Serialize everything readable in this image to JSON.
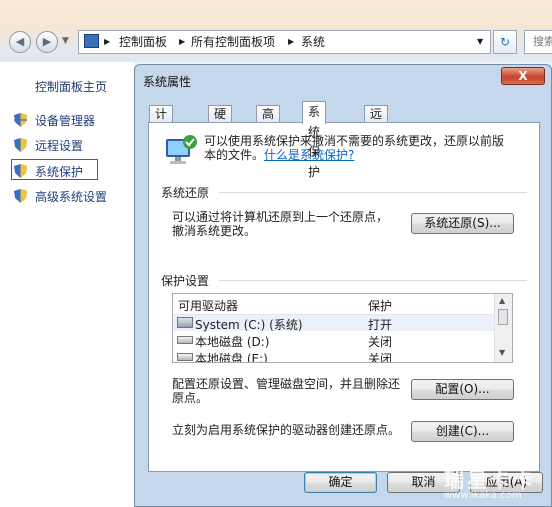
{
  "explorer": {
    "breadcrumb": [
      "控制面板",
      "所有控制面板项",
      "系统"
    ],
    "search_placeholder": "搜索"
  },
  "left_nav": {
    "title": "控制面板主页",
    "items": [
      {
        "label": "设备管理器"
      },
      {
        "label": "远程设置"
      },
      {
        "label": "系统保护"
      },
      {
        "label": "高级系统设置"
      }
    ]
  },
  "dialog": {
    "title": "系统属性",
    "close_label": "X",
    "tabs": [
      "计算机名",
      "硬件",
      "高级",
      "系统保护",
      "远程"
    ],
    "active_tab": "系统保护",
    "intro_text_line1": "可以使用系统保护来撤消不需要的系统更改，还原以前版",
    "intro_text_line2": "本的文件。",
    "intro_link": "什么是系统保护?",
    "restore_group": "系统还原",
    "restore_text_line1": "可以通过将计算机还原到上一个还原点，",
    "restore_text_line2": "撤消系统更改。",
    "restore_button": "系统还原(S)...",
    "protect_group": "保护设置",
    "table_headers": [
      "可用驱动器",
      "保护"
    ],
    "drives": [
      {
        "name": "System (C:) (系统)",
        "status": "打开"
      },
      {
        "name": "本地磁盘 (D:)",
        "status": "关闭"
      },
      {
        "name": "本地磁盘 (E:)",
        "status": "关闭"
      }
    ],
    "configure_text_line1": "配置还原设置、管理磁盘空间，并且删除还",
    "configure_text_line2": "原点。",
    "configure_button": "配置(O)...",
    "create_text": "立刻为启用系统保护的驱动器创建还原点。",
    "create_button": "创建(C)...",
    "ok_button": "确定",
    "cancel_button": "取消",
    "apply_button": "应用(A)"
  },
  "watermark": {
    "title": "瑞星卡卡",
    "url": "www.ikaka.com"
  }
}
